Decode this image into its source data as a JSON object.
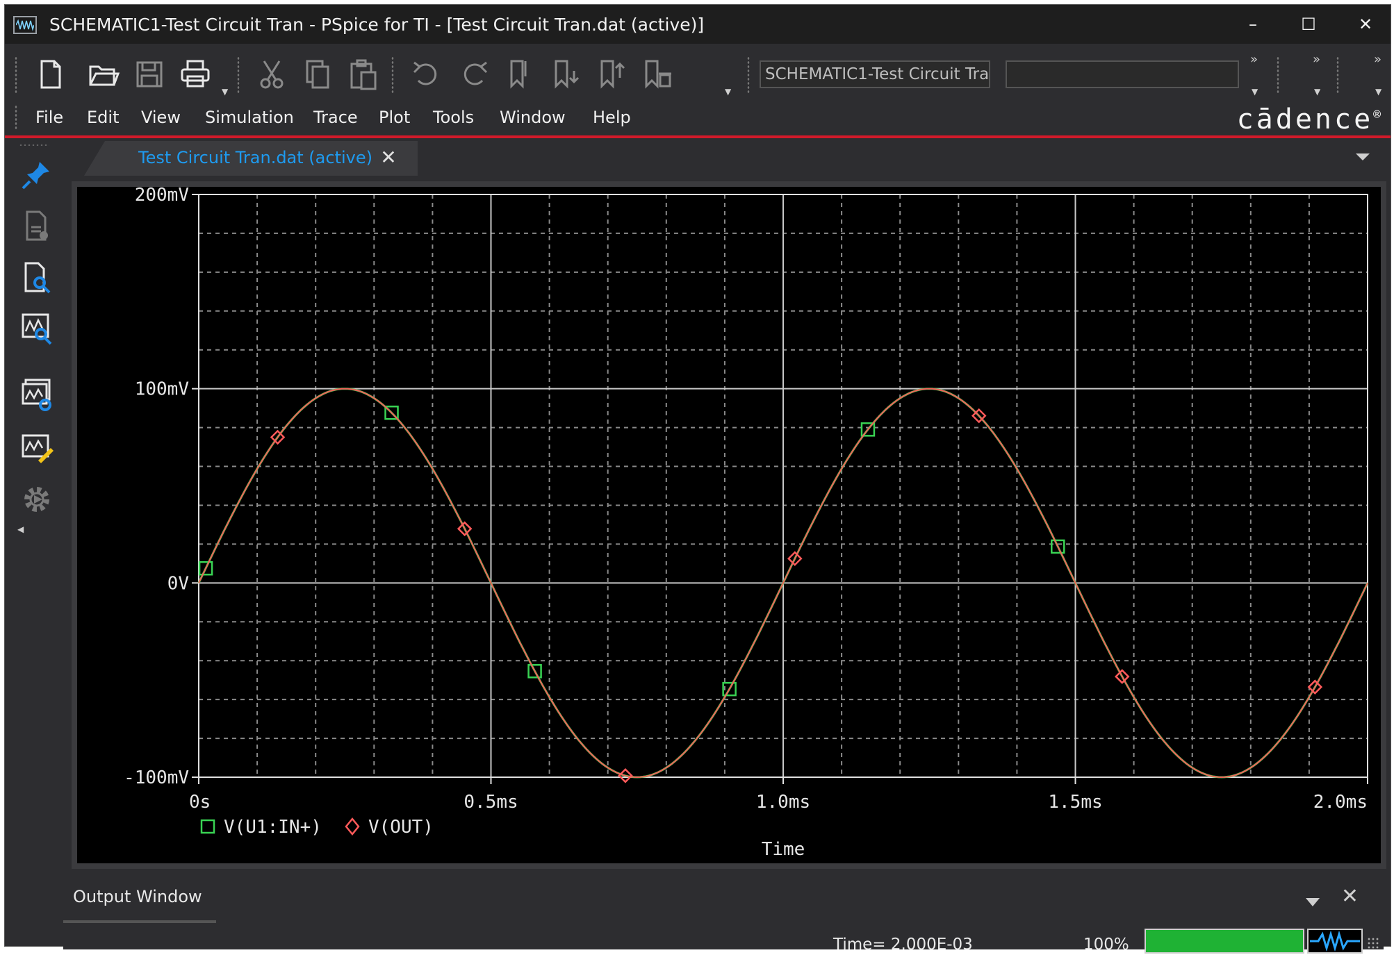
{
  "window": {
    "title": "SCHEMATIC1-Test Circuit Tran - PSpice for TI - [Test Circuit Tran.dat (active)]",
    "minimize": "–",
    "maximize": "☐",
    "close": "✕"
  },
  "toolbar": {
    "icons": [
      "new-icon",
      "open-icon",
      "save-icon",
      "print-icon",
      "cut-icon",
      "copy-icon",
      "paste-icon",
      "undo-icon",
      "redo-icon",
      "bookmark-icon",
      "bookmark-next-icon",
      "bookmark-prev-icon",
      "bookmark-clear-icon"
    ],
    "profile_combo_value": "SCHEMATIC1-Test Circuit Tra",
    "search_combo_value": ""
  },
  "menu": {
    "items": [
      "File",
      "Edit",
      "View",
      "Simulation",
      "Trace",
      "Plot",
      "Tools",
      "Window",
      "Help"
    ],
    "brand": "cādence",
    "brand_mark": "®"
  },
  "left_toolbar": {
    "icons": [
      "pin-icon",
      "document-icon",
      "document-search-icon",
      "waveform-search-icon",
      "waveform-settings-icon",
      "waveform-edit-icon",
      "settings-gear-icon"
    ]
  },
  "tab": {
    "label": "Test Circuit Tran.dat (active)",
    "close": "✕"
  },
  "chart_data": {
    "type": "line",
    "background": "#000000",
    "grid": true,
    "xlabel": "Time",
    "ylabel": "",
    "xlim": [
      0,
      2.0
    ],
    "ylim": [
      -100,
      200
    ],
    "x_units": "ms",
    "y_units": "mV",
    "x_ticks": [
      {
        "value": 0,
        "label": "0s"
      },
      {
        "value": 0.5,
        "label": "0.5ms"
      },
      {
        "value": 1.0,
        "label": "1.0ms"
      },
      {
        "value": 1.5,
        "label": "1.5ms"
      },
      {
        "value": 2.0,
        "label": "2.0ms"
      }
    ],
    "y_ticks": [
      {
        "value": 200,
        "label": "200mV"
      },
      {
        "value": 100,
        "label": "100mV"
      },
      {
        "value": 0,
        "label": "0V"
      },
      {
        "value": -100,
        "label": "-100mV"
      }
    ],
    "series": [
      {
        "name": "V(U1:IN+)",
        "color": "#39d353",
        "marker": "square",
        "x": [
          0,
          0.125,
          0.25,
          0.375,
          0.5,
          0.625,
          0.75,
          0.875,
          1.0,
          1.125,
          1.25,
          1.375,
          1.5,
          1.625,
          1.75,
          1.875,
          2.0
        ],
        "y": [
          0,
          70.7,
          100,
          70.7,
          0,
          -70.7,
          -100,
          -70.7,
          0,
          70.7,
          100,
          70.7,
          0,
          -70.7,
          -100,
          -70.7,
          0
        ],
        "marker_x": [
          0.012,
          0.33,
          0.575,
          0.908,
          1.145,
          1.47
        ]
      },
      {
        "name": "V(OUT)",
        "color": "#ff5a5a",
        "marker": "diamond",
        "x": [
          0,
          0.125,
          0.25,
          0.375,
          0.5,
          0.625,
          0.75,
          0.875,
          1.0,
          1.125,
          1.25,
          1.375,
          1.5,
          1.625,
          1.75,
          1.875,
          2.0
        ],
        "y": [
          0,
          70.7,
          100,
          70.7,
          0,
          -70.7,
          -100,
          -70.7,
          0,
          70.7,
          100,
          70.7,
          0,
          -70.7,
          -100,
          -70.7,
          0
        ],
        "marker_x": [
          0.135,
          0.455,
          0.73,
          1.02,
          1.335,
          1.58,
          1.91
        ]
      }
    ]
  },
  "output": {
    "title": "Output Window",
    "close": "✕"
  },
  "status": {
    "time": "Time= 2.000E-03",
    "percent": "100%",
    "progress": 1.0
  }
}
